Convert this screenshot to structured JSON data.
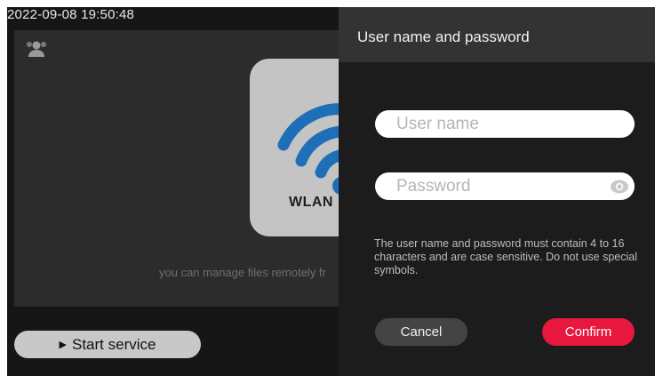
{
  "status_bar": {
    "timestamp": "2022-09-08 19:50:48"
  },
  "main": {
    "wlan_label": "WLAN",
    "remote_text": "you can manage files remotely fr",
    "start_button": {
      "icon": "play-triangle-icon",
      "label": "Start service"
    }
  },
  "dialog": {
    "title": "User name and password",
    "username": {
      "placeholder": "User name",
      "value": ""
    },
    "password": {
      "placeholder": "Password",
      "value": "",
      "icon": "eye-icon"
    },
    "note": "The user name and password must contain 4 to 16 characters and are case sensitive. Do not use special symbols.",
    "cancel_label": "Cancel",
    "confirm_label": "Confirm"
  },
  "colors": {
    "accent": "#e8173d",
    "wifi_blue": "#1f6fb8",
    "screen_bg": "#161616"
  }
}
